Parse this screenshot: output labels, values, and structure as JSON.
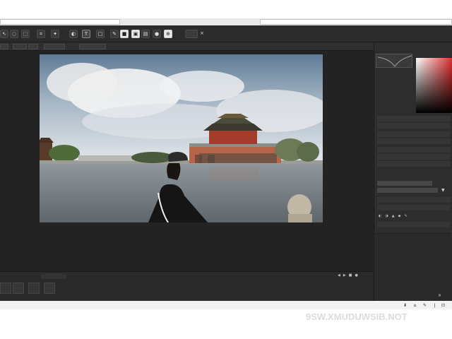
{
  "titlebar": {
    "left_field": "",
    "center_field": "",
    "right_field": ""
  },
  "toolbar": {
    "tools": [
      {
        "name": "select-tool",
        "glyph": "↖"
      },
      {
        "name": "lasso-tool",
        "glyph": "◌"
      },
      {
        "name": "transform-tool",
        "glyph": "⬚"
      },
      {
        "name": "crop-tool",
        "glyph": "⌗"
      },
      {
        "name": "heal-tool",
        "glyph": "✦"
      },
      {
        "name": "clone-tool",
        "glyph": "◐"
      },
      {
        "name": "text-tool",
        "glyph": "T"
      },
      {
        "name": "shape-tool",
        "glyph": "□"
      },
      {
        "name": "brush-tool",
        "glyph": "✎"
      },
      {
        "name": "eraser-tool",
        "glyph": "■"
      },
      {
        "name": "fill-tool",
        "glyph": "▣"
      },
      {
        "name": "gradient-tool",
        "glyph": "▤"
      },
      {
        "name": "dodge-tool",
        "glyph": "●"
      },
      {
        "name": "zoom-tool",
        "glyph": "⊕"
      }
    ],
    "mode_button": "",
    "close_glyph": "×"
  },
  "options_bar": {
    "items": [
      "",
      "",
      "",
      "",
      ""
    ]
  },
  "right_panel": {
    "header": "",
    "rows": [
      "",
      "",
      "",
      "",
      "",
      "",
      "",
      "",
      "",
      ""
    ],
    "icon_row": [
      "◐",
      "◑",
      "▲",
      "◆",
      "✎"
    ],
    "corner_icon": "×"
  },
  "timeline": {
    "tabs": [
      "",
      ""
    ],
    "buttons": [
      "",
      "",
      "",
      ""
    ],
    "controls": [
      "◀",
      "▶",
      "■",
      "●"
    ]
  },
  "bottom_bar": {
    "icons": [
      "⬇",
      "⌂",
      "✎",
      "ǀ",
      "⊡"
    ]
  },
  "watermark": "9SW.XMUDUWSIB.NOT",
  "colors": {
    "app_bg": "#262626",
    "panel_bg": "#2d2d2d",
    "accent_red": "#e23030"
  }
}
